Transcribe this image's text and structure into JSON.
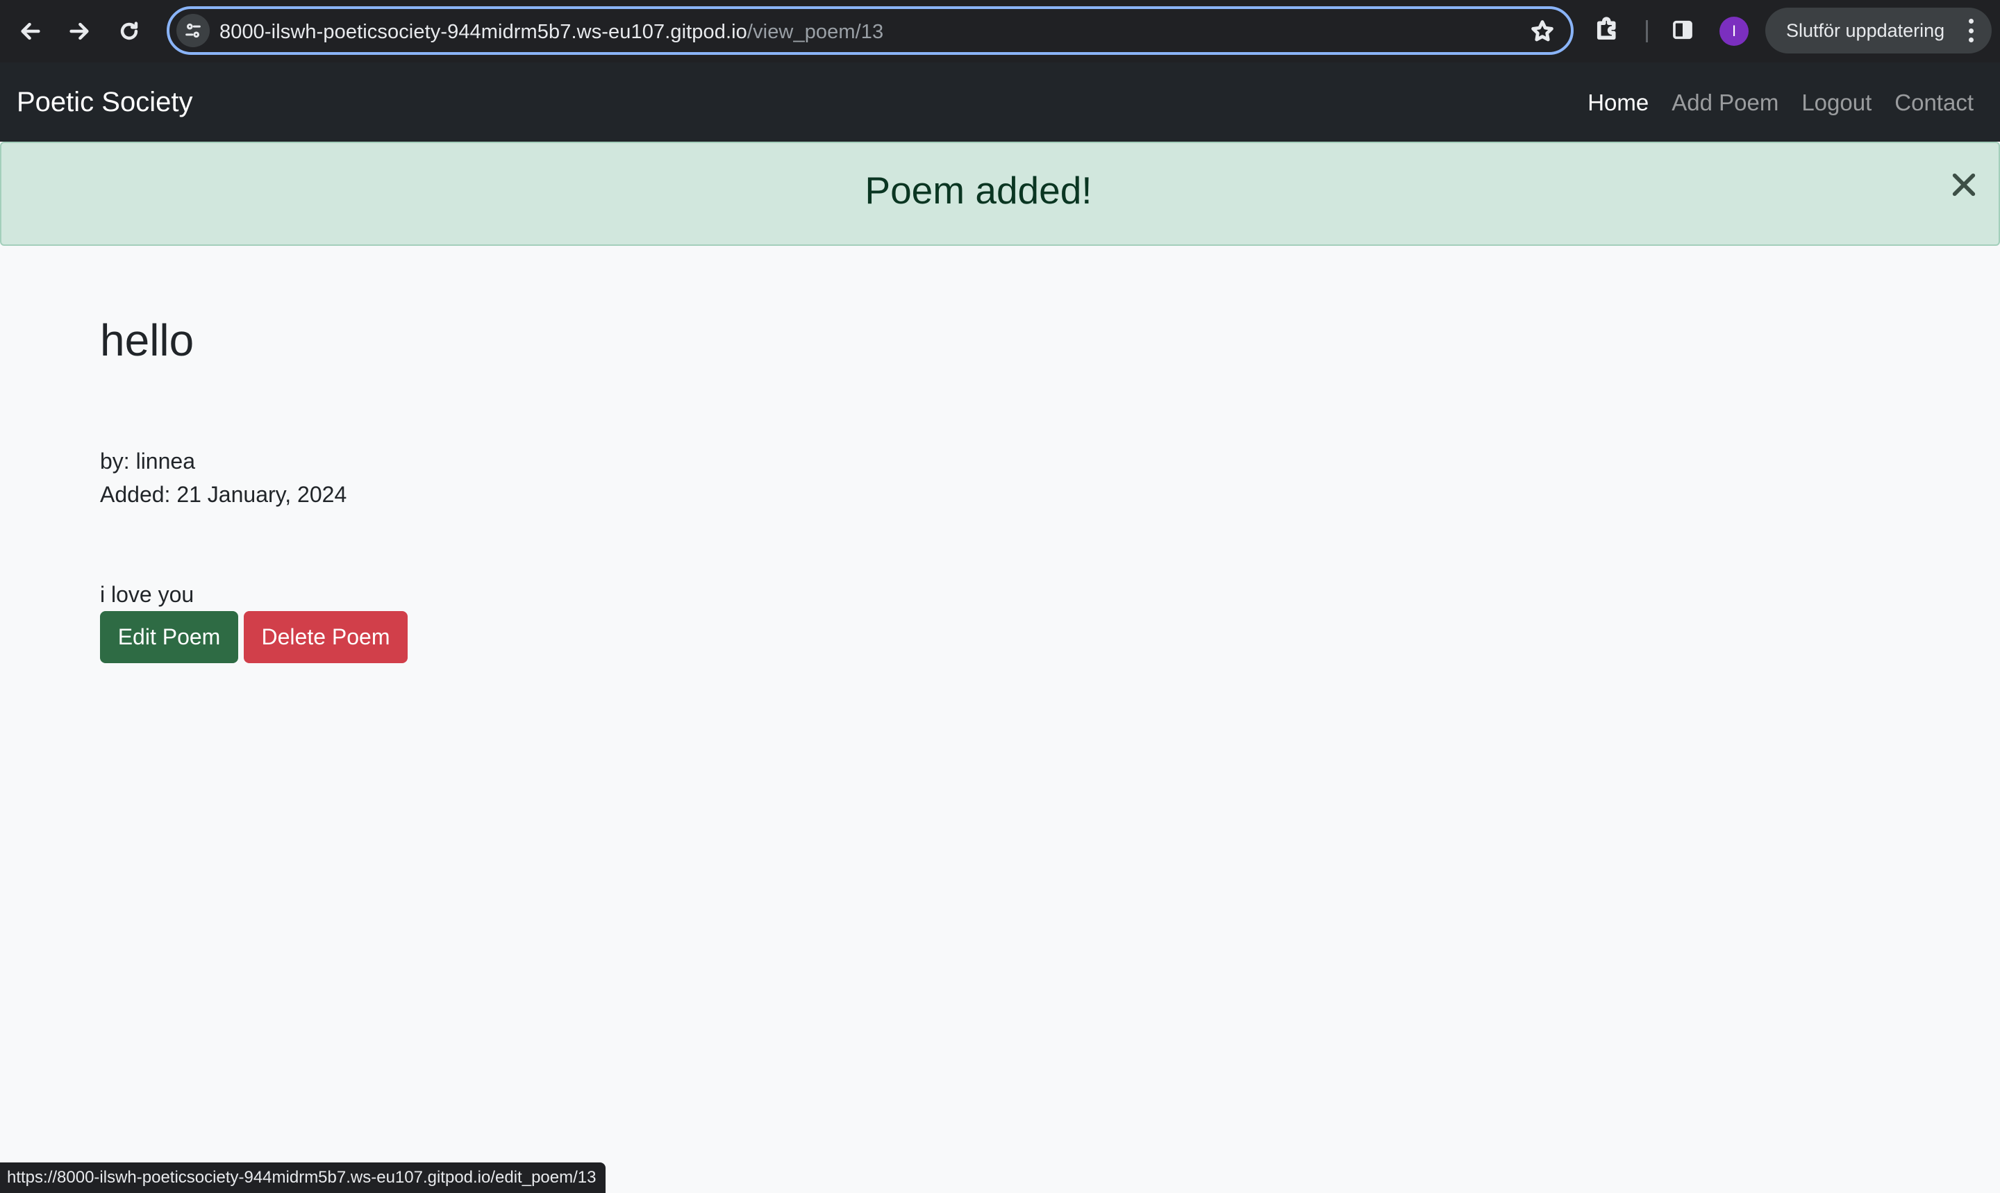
{
  "browser": {
    "url_host": "8000-ilswh-poeticsociety-944midrm5b7.ws-eu107.gitpod.io",
    "url_path": "/view_poem/13",
    "profile_initial": "I",
    "update_label": "Slutför uppdatering",
    "status_url": "https://8000-ilswh-poeticsociety-944midrm5b7.ws-eu107.gitpod.io/edit_poem/13",
    "icons": {
      "back": "back-arrow-icon",
      "forward": "forward-arrow-icon",
      "reload": "reload-icon",
      "site_info": "tune-icon",
      "bookmark": "star-icon",
      "extensions": "puzzle-icon",
      "side_panel": "side-panel-icon",
      "menu": "more-vert-icon"
    }
  },
  "navbar": {
    "brand": "Poetic Society",
    "links": [
      {
        "label": "Home",
        "active": true
      },
      {
        "label": "Add Poem",
        "active": false
      },
      {
        "label": "Logout",
        "active": false
      },
      {
        "label": "Contact",
        "active": false
      }
    ]
  },
  "alert": {
    "message": "Poem added!",
    "color": "#d1e7dd"
  },
  "poem": {
    "title": "hello",
    "author_line": "by: linnea",
    "added_line": "Added: 21 January, 2024",
    "body": "i love you"
  },
  "actions": {
    "edit_label": "Edit Poem",
    "delete_label": "Delete Poem",
    "edit_color": "#2e6b44",
    "delete_color": "#d13f4a"
  }
}
